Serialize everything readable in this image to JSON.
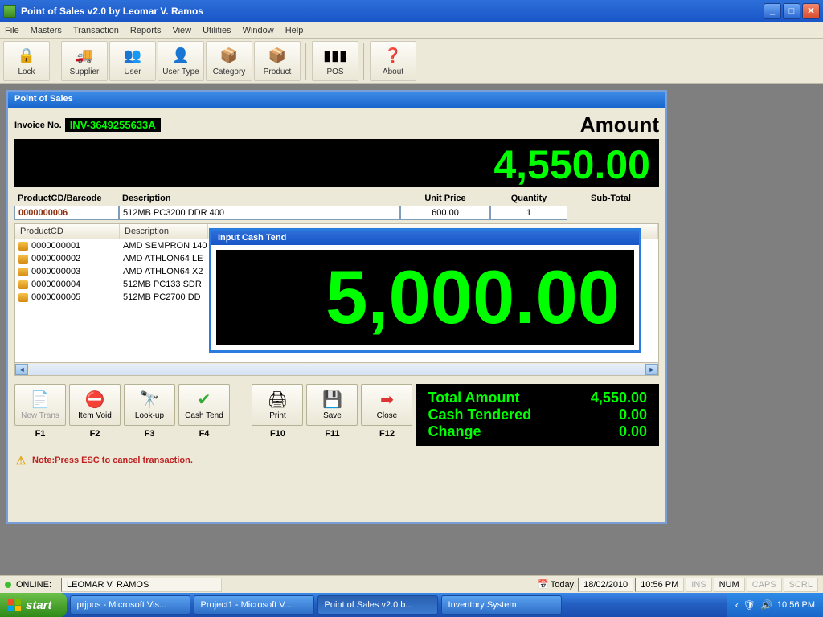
{
  "window": {
    "title": "Point of Sales v2.0 by Leomar V. Ramos"
  },
  "menu": {
    "file": "File",
    "masters": "Masters",
    "transaction": "Transaction",
    "reports": "Reports",
    "view": "View",
    "utilities": "Utilities",
    "window": "Window",
    "help": "Help"
  },
  "toolbar": {
    "lock": "Lock",
    "supplier": "Supplier",
    "user": "User",
    "usertype": "User Type",
    "category": "Category",
    "product": "Product",
    "pos": "POS",
    "about": "About"
  },
  "pos": {
    "title": "Point of Sales",
    "invoice_label": "Invoice No.",
    "invoice_no": "INV-3649255633A",
    "amount_label": "Amount",
    "amount_display": "4,550.00",
    "cols": {
      "pcd": "ProductCD/Barcode",
      "desc": "Description",
      "up": "Unit Price",
      "qty": "Quantity",
      "sub": "Sub-Total"
    },
    "entry": {
      "pcd": "0000000006",
      "desc": "512MB PC3200 DDR 400",
      "up": "600.00",
      "qty": "1"
    },
    "grid": {
      "head": {
        "pcd": "ProductCD",
        "desc": "Description"
      },
      "rows": [
        {
          "pcd": "0000000001",
          "desc": "AMD SEMPRON 140"
        },
        {
          "pcd": "0000000002",
          "desc": "AMD ATHLON64 LE"
        },
        {
          "pcd": "0000000003",
          "desc": "AMD ATHLON64 X2"
        },
        {
          "pcd": "0000000004",
          "desc": "512MB PC133 SDR"
        },
        {
          "pcd": "0000000005",
          "desc": "512MB PC2700 DD"
        }
      ]
    },
    "buttons": {
      "newtrans": {
        "label": "New Trans",
        "fkey": "F1"
      },
      "itemvoid": {
        "label": "Item Void",
        "fkey": "F2"
      },
      "lookup": {
        "label": "Look-up",
        "fkey": "F3"
      },
      "cashtend": {
        "label": "Cash Tend",
        "fkey": "F4"
      },
      "print": {
        "label": "Print",
        "fkey": "F10"
      },
      "save": {
        "label": "Save",
        "fkey": "F11"
      },
      "close": {
        "label": "Close",
        "fkey": "F12"
      }
    },
    "totals": {
      "total_label": "Total Amount",
      "total_value": "4,550.00",
      "tendered_label": "Cash Tendered",
      "tendered_value": "0.00",
      "change_label": "Change",
      "change_value": "0.00"
    },
    "note": "Note:Press ESC to cancel transaction."
  },
  "cash_dialog": {
    "title": "Input Cash Tend",
    "value": "5,000.00"
  },
  "statusbar": {
    "online": "ONLINE:",
    "user": "LEOMAR V. RAMOS",
    "today_label": "Today:",
    "date": "18/02/2010",
    "time": "10:56 PM",
    "ins": "INS",
    "num": "NUM",
    "caps": "CAPS",
    "scrl": "SCRL"
  },
  "taskbar": {
    "start": "start",
    "items": [
      "prjpos - Microsoft Vis...",
      "Project1 - Microsoft V...",
      "Point of Sales v2.0 b...",
      "Inventory System"
    ],
    "clock": "10:56 PM"
  }
}
